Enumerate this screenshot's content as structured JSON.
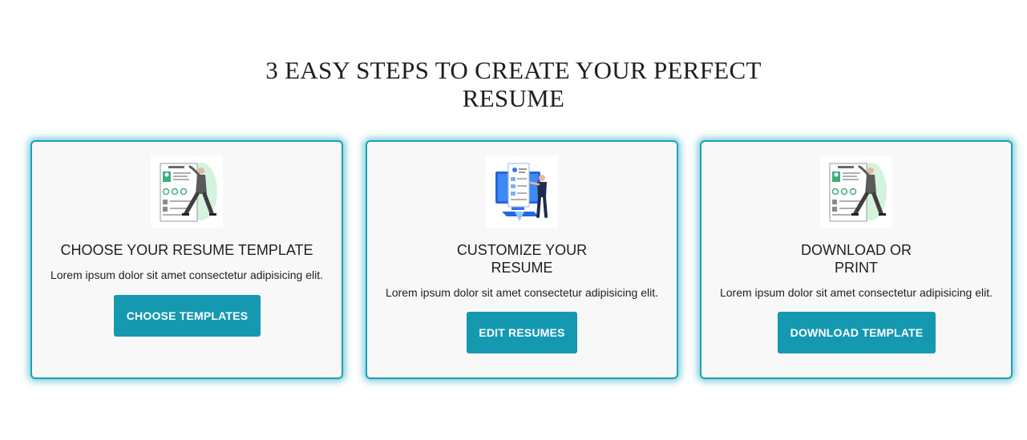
{
  "section": {
    "heading_line_1": "3 EASY STEPS TO CREATE YOUR PERFECT",
    "heading_line_2": "RESUME"
  },
  "steps": [
    {
      "illustration_icon": "resume-template-illustration-icon",
      "title_line_1": "CHOOSE YOUR RESUME TEMPLATE",
      "title_line_2": "",
      "description": "Lorem ipsum dolor sit amet consectetur adipisicing elit.",
      "button_label": "CHOOSE TEMPLATES"
    },
    {
      "illustration_icon": "customize-resume-illustration-icon",
      "title_line_1": "CUSTOMIZE YOUR",
      "title_line_2": "RESUME",
      "description": "Lorem ipsum dolor sit amet consectetur adipisicing elit.",
      "button_label": "EDIT RESUMES"
    },
    {
      "illustration_icon": "resume-template-illustration-icon",
      "title_line_1": "DOWNLOAD OR",
      "title_line_2": "PRINT",
      "description": "Lorem ipsum dolor sit amet consectetur adipisicing elit.",
      "button_label": "DOWNLOAD TEMPLATE"
    }
  ],
  "colors": {
    "accent": "#1499b1",
    "card_border": "#1aa1b9",
    "card_background": "#f8f8f8",
    "text": "#1e1e1e"
  }
}
